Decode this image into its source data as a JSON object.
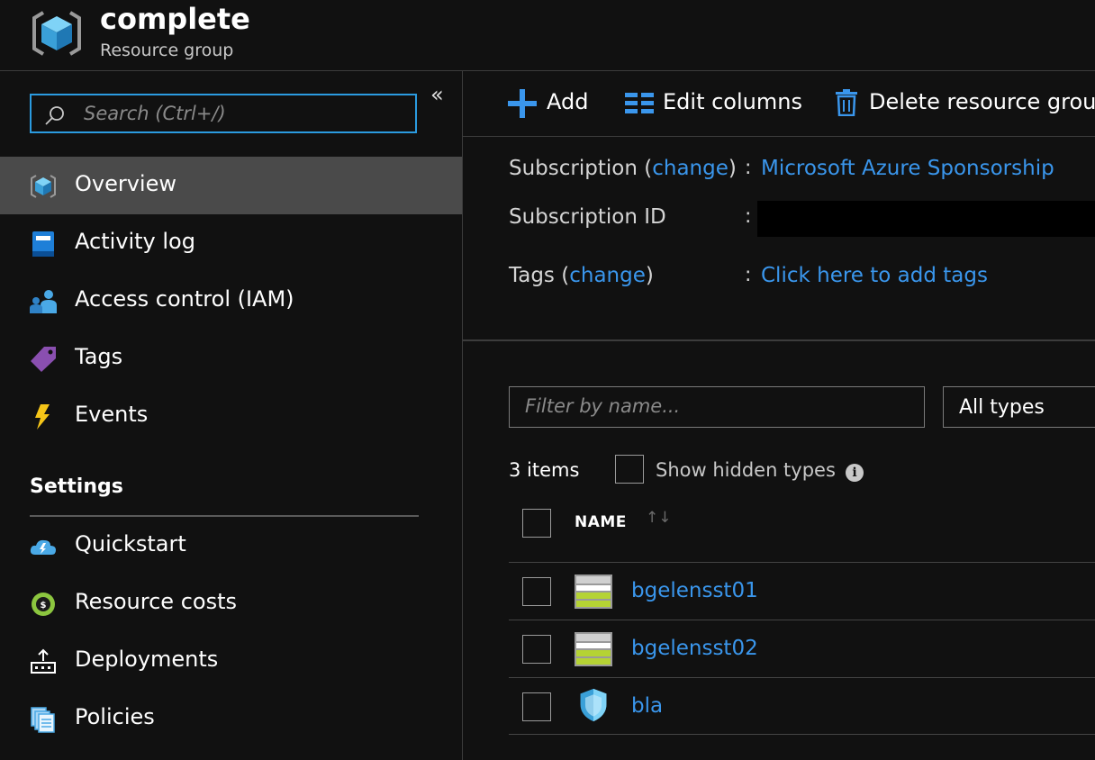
{
  "header": {
    "title": "complete",
    "subtitle": "Resource group"
  },
  "sidebar": {
    "search_placeholder": "Search (Ctrl+/)",
    "collapse_glyph": "«",
    "items": [
      {
        "label": "Overview",
        "icon": "resource-group-icon",
        "active": true
      },
      {
        "label": "Activity log",
        "icon": "activity-log-icon"
      },
      {
        "label": "Access control (IAM)",
        "icon": "access-control-icon"
      },
      {
        "label": "Tags",
        "icon": "tag-icon"
      },
      {
        "label": "Events",
        "icon": "lightning-icon"
      }
    ],
    "settings_heading": "Settings",
    "settings_items": [
      {
        "label": "Quickstart",
        "icon": "quickstart-cloud-icon"
      },
      {
        "label": "Resource costs",
        "icon": "cost-icon"
      },
      {
        "label": "Deployments",
        "icon": "deployments-icon"
      },
      {
        "label": "Policies",
        "icon": "policies-icon"
      }
    ]
  },
  "toolbar": {
    "add_label": "Add",
    "edit_columns_label": "Edit columns",
    "delete_label": "Delete resource group"
  },
  "essentials": {
    "subscription_label": "Subscription",
    "change_link": "change",
    "subscription_value": "Microsoft Azure Sponsorship",
    "subscription_id_label": "Subscription ID",
    "tags_label": "Tags",
    "tags_value": "Click here to add tags",
    "colon": ":"
  },
  "filter": {
    "placeholder": "Filter by name...",
    "type_value": "All types"
  },
  "list": {
    "items_count": "3 items",
    "show_hidden_label": "Show hidden types",
    "name_header": "NAME",
    "rows": [
      {
        "name": "bgelensst01",
        "icon": "storage-account-icon"
      },
      {
        "name": "bgelensst02",
        "icon": "storage-account-icon"
      },
      {
        "name": "bla",
        "icon": "security-shield-icon"
      }
    ]
  },
  "colors": {
    "accent": "#3a96ec",
    "background": "#111111",
    "active_row": "#4a4a4a",
    "search_border": "#2b9be0"
  }
}
